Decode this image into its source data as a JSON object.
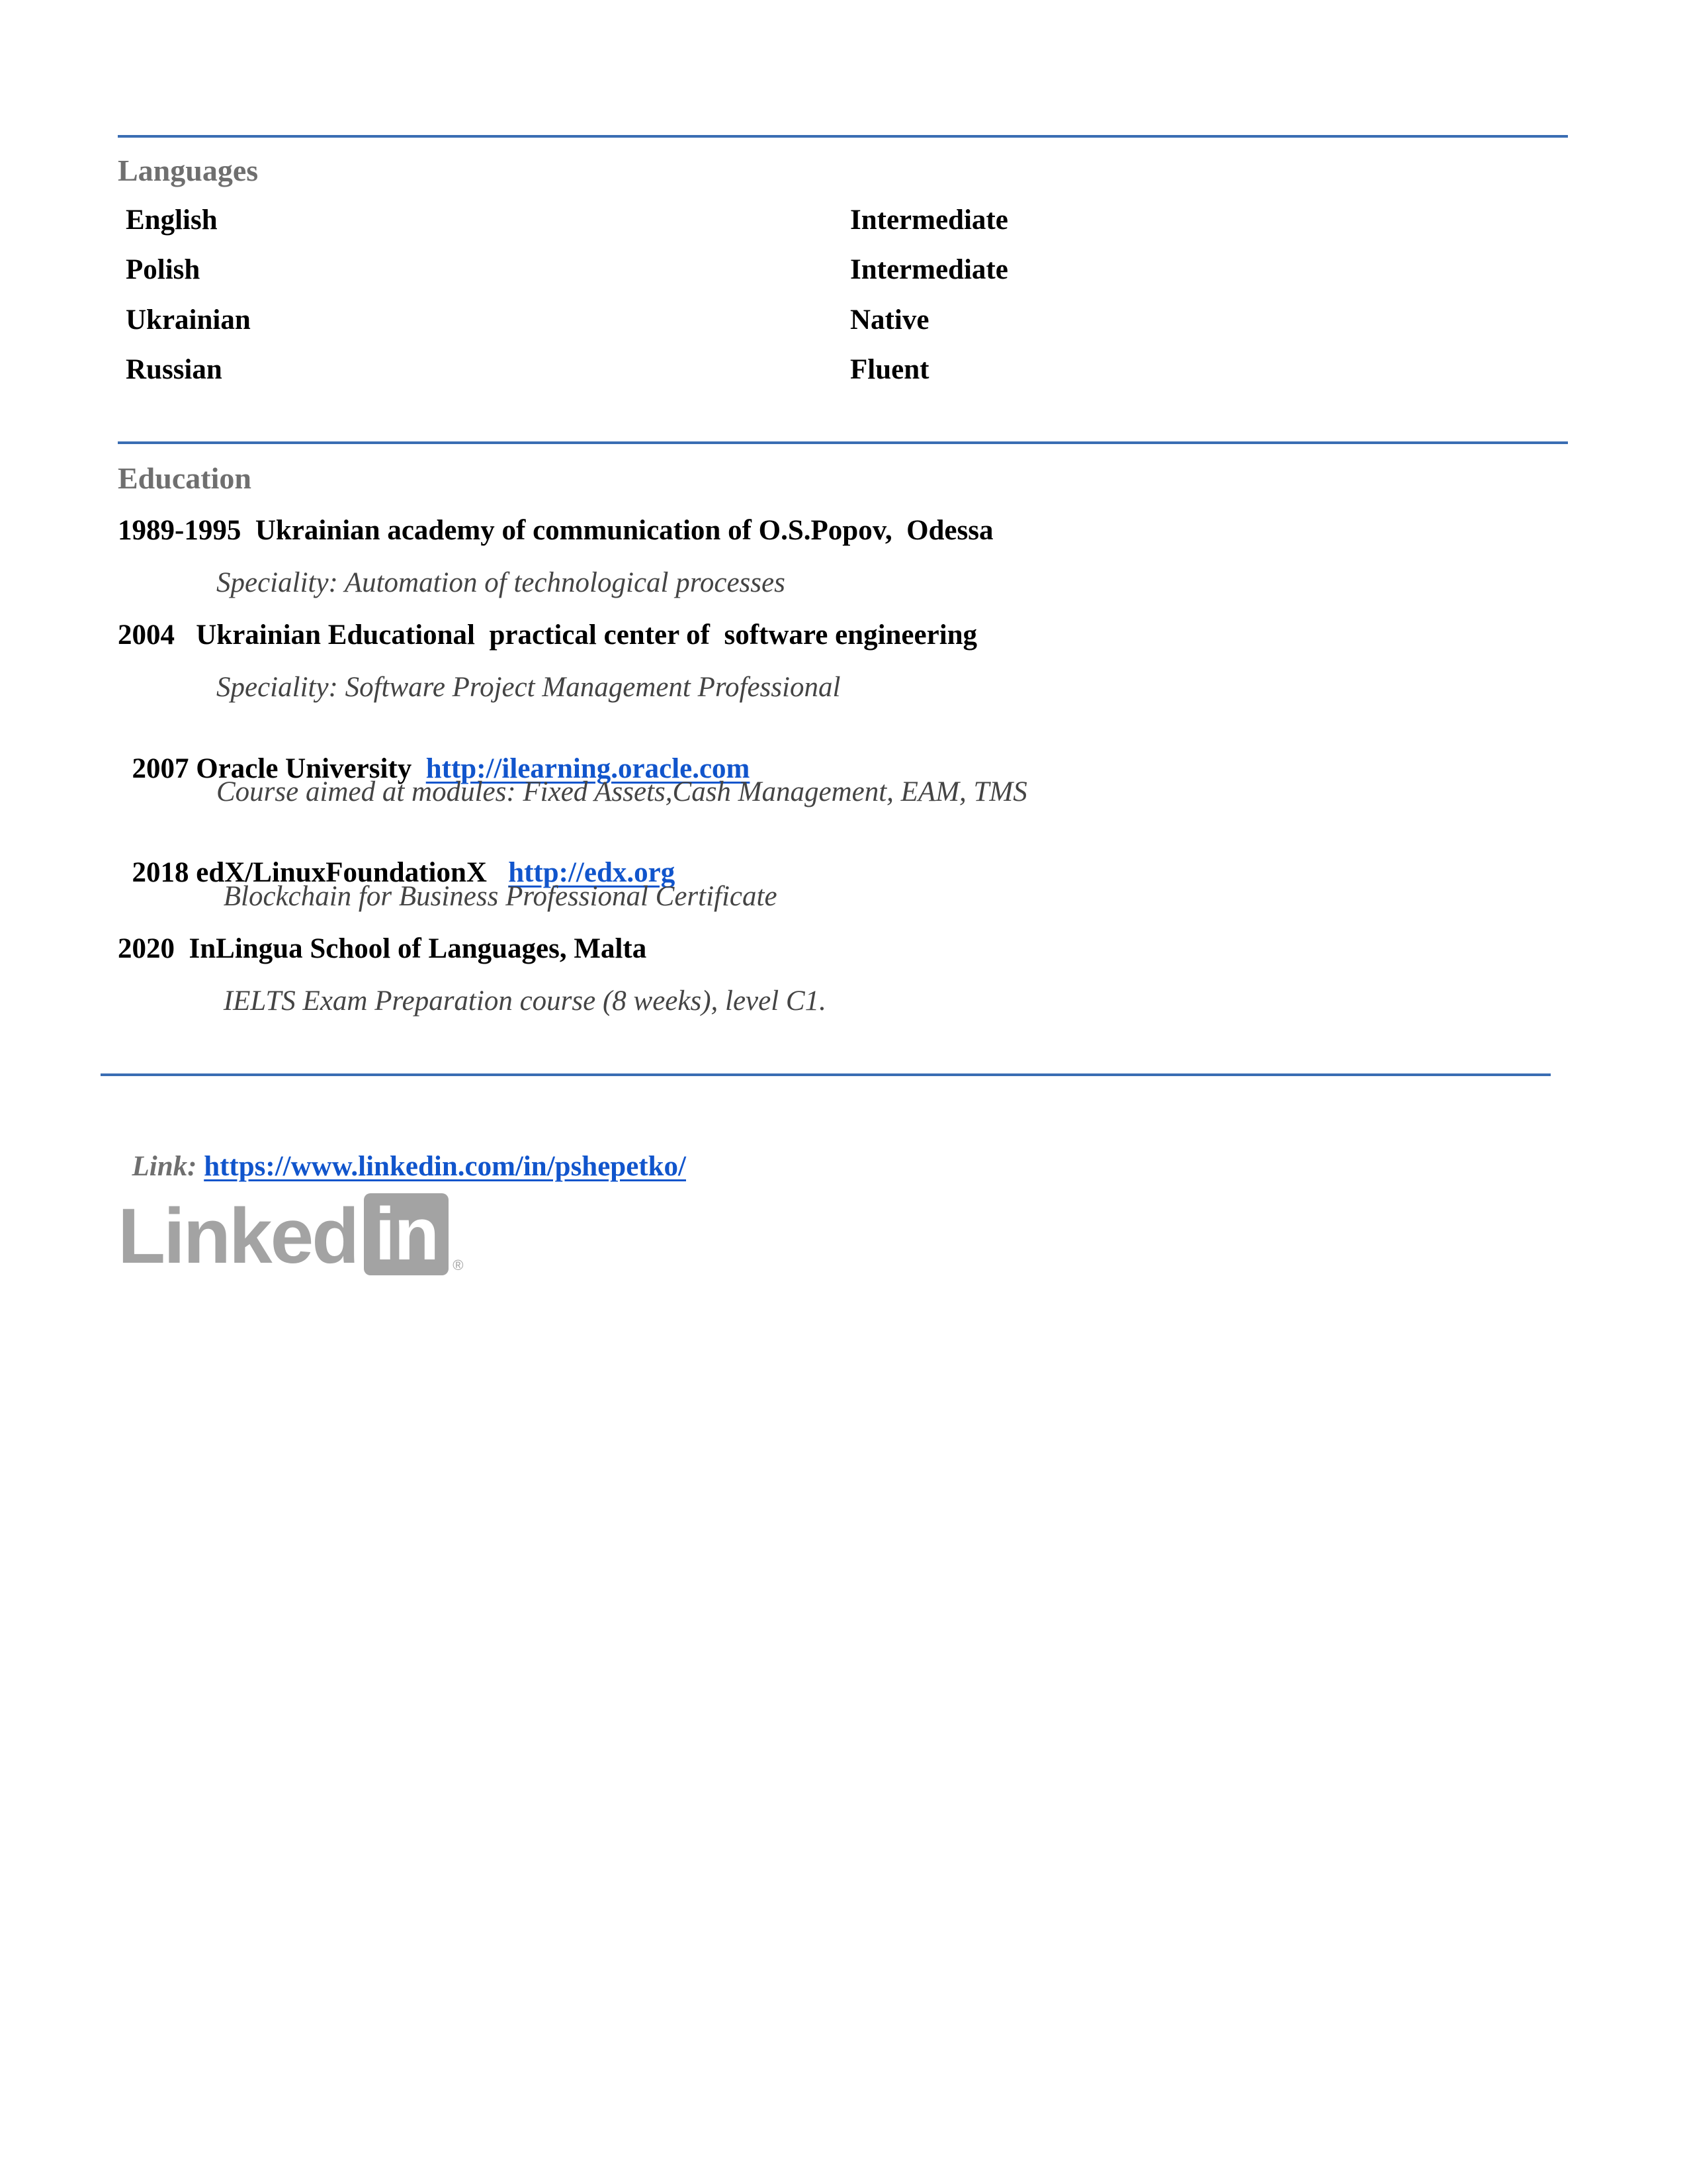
{
  "languages": {
    "title": "Languages",
    "items": [
      {
        "name": "English",
        "level": "Intermediate"
      },
      {
        "name": "Polish",
        "level": "Intermediate"
      },
      {
        "name": "Ukrainian",
        "level": "Native"
      },
      {
        "name": "Russian",
        "level": "Fluent"
      }
    ]
  },
  "education": {
    "title": "Education",
    "entries": [
      {
        "heading": "1989-1995  Ukrainian academy of communication of O.S.Popov,  Odessa",
        "detail": "Speciality: Automation of technological processes"
      },
      {
        "heading": "2004   Ukrainian Educational  practical center of  software engineering",
        "detail": "Speciality: Software Project Management Professional"
      },
      {
        "heading": "2007 Oracle University  ",
        "link": "http://ilearning.oracle.com",
        "detail": "Course aimed at modules: Fixed Assets,Cash Management, EAM, TMS"
      },
      {
        "heading": "2018 edX/LinuxFoundationX   ",
        "link": "http://edx.org",
        "detail": " Blockchain for Business Professional Certificate"
      },
      {
        "heading": "2020  InLingua School of Languages, Malta",
        "detail": " IELTS Exam Preparation course (8 weeks), level C1."
      }
    ]
  },
  "profile_link": {
    "label": "Link:",
    "url": "https://www.linkedin.com/in/pshepetko/"
  },
  "logo": {
    "word": "Linked",
    "box": "in",
    "reg": "®",
    "icon": "linkedin-logo",
    "color": "#a3a3a3"
  },
  "colors": {
    "rule": "#3a6db3",
    "link": "#1155cc",
    "section_title": "#6f6f6f"
  }
}
